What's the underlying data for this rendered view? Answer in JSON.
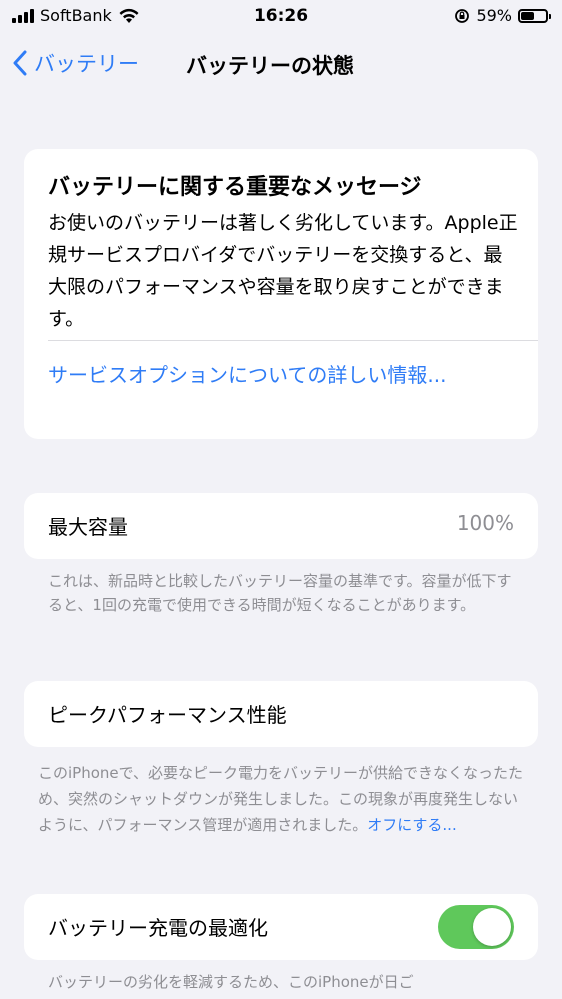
{
  "status_bar": {
    "carrier": "SoftBank",
    "time": "16:26",
    "battery_percent": "59%",
    "battery_level": 0.59
  },
  "nav": {
    "back_label": "バッテリー",
    "title": "バッテリーの状態"
  },
  "message_card": {
    "title": "バッテリーに関する重要なメッセージ",
    "body": "お使いのバッテリーは著しく劣化しています。Apple正規サービスプロバイダでバッテリーを交換すると、最大限のパフォーマンスや容量を取り戻すことができます。",
    "link": "サービスオプションについての詳しい情報..."
  },
  "capacity": {
    "label": "最大容量",
    "value": "100%",
    "note": "これは、新品時と比較したバッテリー容量の基準です。容量が低下すると、1回の充電で使用できる時間が短くなることがあります。"
  },
  "peak_performance": {
    "label": "ピークパフォーマンス性能",
    "note": "このiPhoneで、必要なピーク電力をバッテリーが供給できなくなったため、突然のシャットダウンが発生しました。この現象が再度発生しないように、パフォーマンス管理が適用されました。",
    "note_link": "オフにする..."
  },
  "optimized_charging": {
    "label": "バッテリー充電の最適化",
    "enabled": true,
    "note": "バッテリーの劣化を軽減するため、このiPhoneが日ご"
  },
  "colors": {
    "accent": "#2f7cf6",
    "toggle_on": "#5fc85b",
    "background": "#f2f2f7"
  }
}
